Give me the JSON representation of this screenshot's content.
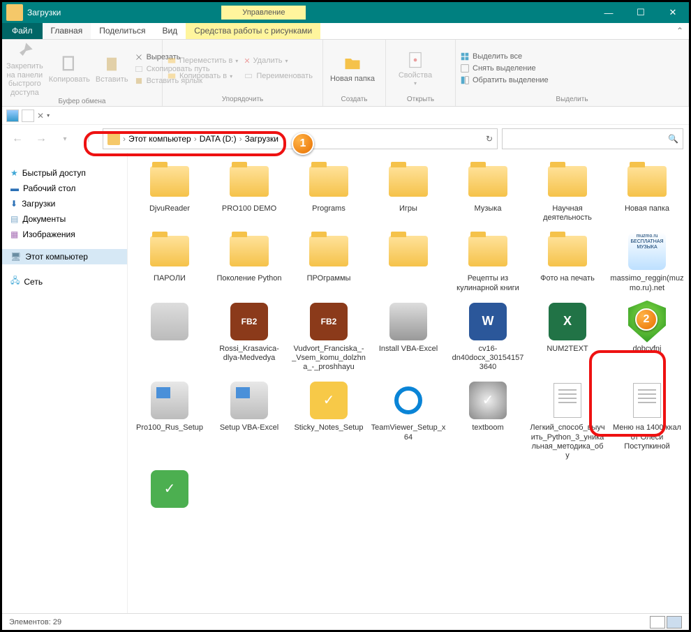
{
  "window": {
    "title": "Загрузки",
    "context_tab": "Управление"
  },
  "menu": {
    "file": "Файл",
    "tabs": [
      "Главная",
      "Поделиться",
      "Вид"
    ],
    "context": "Средства работы с рисунками"
  },
  "ribbon": {
    "clipboard": {
      "pin": "Закрепить на панели быстрого доступа",
      "copy": "Копировать",
      "paste": "Вставить",
      "cut": "Вырезать",
      "copypath": "Скопировать путь",
      "pastesc": "Вставить ярлык",
      "label": "Буфер обмена"
    },
    "organize": {
      "move": "Переместить в",
      "copyto": "Копировать в",
      "delete": "Удалить",
      "rename": "Переименовать",
      "label": "Упорядочить"
    },
    "new": {
      "newfolder": "Новая папка",
      "label": "Создать"
    },
    "open": {
      "props": "Свойства",
      "label": "Открыть"
    },
    "select": {
      "all": "Выделить все",
      "none": "Снять выделение",
      "invert": "Обратить выделение",
      "label": "Выделить"
    }
  },
  "address": {
    "parts": [
      "Этот компьютер",
      "DATA (D:)",
      "Загрузки"
    ]
  },
  "search": {
    "placeholder": ""
  },
  "sidebar": {
    "items": [
      {
        "label": "Быстрый доступ",
        "color": "#3fa7d6"
      },
      {
        "label": "Рабочий стол",
        "color": "#2a6fb5"
      },
      {
        "label": "Загрузки",
        "color": "#2a6fb5"
      },
      {
        "label": "Документы",
        "color": "#7da9c9"
      },
      {
        "label": "Изображения",
        "color": "#a76fb5"
      },
      {
        "label": "Этот компьютер",
        "color": "#6b8ea3"
      },
      {
        "label": "Сеть",
        "color": "#3fa7d6"
      }
    ]
  },
  "files": [
    {
      "name": "DjvuReader",
      "type": "folder"
    },
    {
      "name": "PRO100 DEMO",
      "type": "folder"
    },
    {
      "name": "Programs",
      "type": "folder"
    },
    {
      "name": "Игры",
      "type": "folder"
    },
    {
      "name": "Музыка",
      "type": "folder"
    },
    {
      "name": "Научная деятельность",
      "type": "folder"
    },
    {
      "name": "Новая папка",
      "type": "folder"
    },
    {
      "name": "ПАРОЛИ",
      "type": "folder"
    },
    {
      "name": "Поколение Python",
      "type": "folder"
    },
    {
      "name": "ПРОграммы",
      "type": "folder"
    },
    {
      "name": "",
      "type": "folder"
    },
    {
      "name": "Рецепты из кулинарной книги",
      "type": "folder"
    },
    {
      "name": "Фото на печать",
      "type": "folder"
    },
    {
      "name": "massimo_reggin(muzmo.ru).net",
      "type": "image",
      "bg": "linear-gradient(#fff,#bde0ff)",
      "overlay": "muzmo.ru\\nБЕСПЛАТНАЯ\\nМУЗЫКА"
    },
    {
      "name": "",
      "type": "image",
      "bg": "linear-gradient(#ddd,#bbb)"
    },
    {
      "name": "Rossi_Krasavica-dlya-Medvedya",
      "type": "fb2"
    },
    {
      "name": "Vudvort_Franciska_-_Vsem_komu_dolzhna_-_proshhayu",
      "type": "fb2"
    },
    {
      "name": "Install VBA-Excel",
      "type": "archive"
    },
    {
      "name": "cv16-dn40docx_301541573640",
      "type": "word"
    },
    {
      "name": "NUM2TEXT",
      "type": "excel"
    },
    {
      "name": "dobcyfnj",
      "type": "drweb"
    },
    {
      "name": "Pro100_Rus_Setup",
      "type": "installer"
    },
    {
      "name": "Setup VBA-Excel",
      "type": "installer"
    },
    {
      "name": "Sticky_Notes_Setup",
      "type": "app",
      "bg": "#f7c948"
    },
    {
      "name": "TeamViewer_Setup_x64",
      "type": "app",
      "bg": "#fff"
    },
    {
      "name": "textboom",
      "type": "app",
      "bg": "radial-gradient(circle,#eee,#888)"
    },
    {
      "name": "Легкий_способ_выучить_Python_3_уникальная_методика_обу",
      "type": "doc"
    },
    {
      "name": "Меню на 1400 ккал от Олеси Поступкиной",
      "type": "doc"
    },
    {
      "name": "",
      "type": "app",
      "bg": "#4caf50"
    }
  ],
  "status": {
    "count_label": "Элементов:",
    "count": "29"
  }
}
